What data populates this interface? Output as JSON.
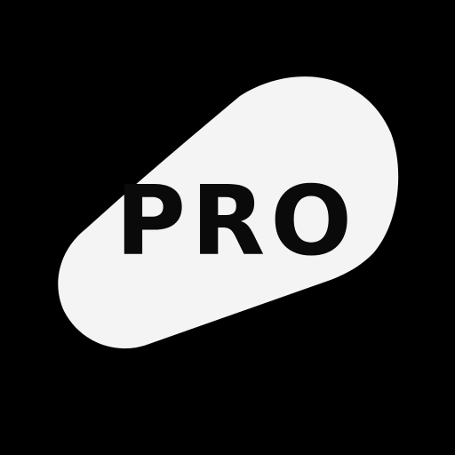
{
  "app_icon": {
    "label": "PRO",
    "icon": "pro-badge-icon",
    "colors": {
      "background": "#000000",
      "badge": "#f4f4f4",
      "text": "#0a0a0a"
    }
  }
}
